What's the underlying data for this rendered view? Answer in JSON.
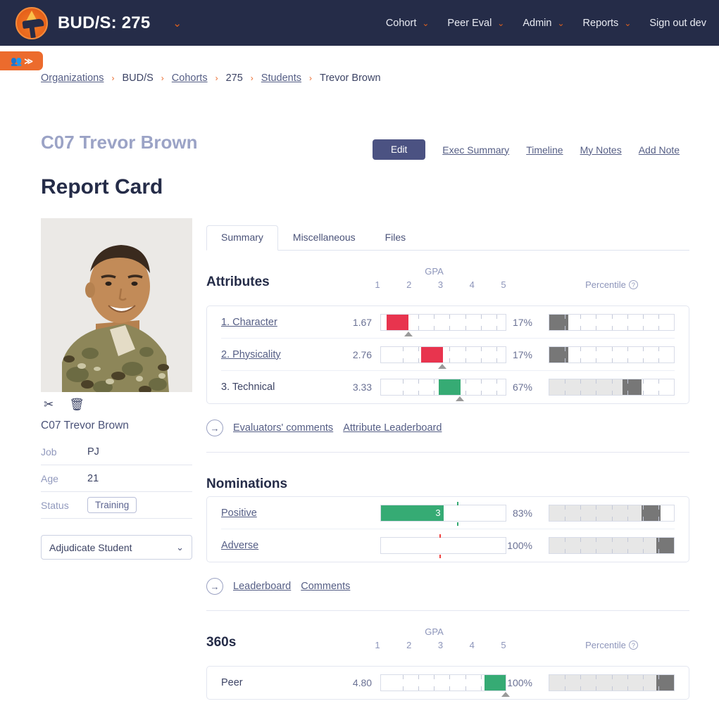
{
  "header": {
    "brand_title": "BUD/S: 275",
    "brand_caret": "⌄",
    "nav": [
      {
        "label": "Cohort",
        "caret": "⌄"
      },
      {
        "label": "Peer Eval",
        "caret": "⌄"
      },
      {
        "label": "Admin",
        "caret": "⌄"
      },
      {
        "label": "Reports",
        "caret": "⌄"
      },
      {
        "label": "Sign out dev",
        "caret": ""
      }
    ],
    "side_toggle": {
      "icon": "people-icon",
      "label": "≫"
    }
  },
  "breadcrumb": {
    "items": [
      {
        "label": "Organizations",
        "link": true
      },
      {
        "label": "BUD/S",
        "link": false
      },
      {
        "label": "Cohorts",
        "link": true
      },
      {
        "label": "275",
        "link": false
      },
      {
        "label": "Students",
        "link": true
      },
      {
        "label": "Trevor Brown",
        "link": false
      }
    ],
    "separator": "›"
  },
  "page": {
    "student_name": "C07 Trevor Brown",
    "title": "Report Card",
    "actions": {
      "edit_label": "Edit",
      "links": [
        "Exec Summary",
        "Timeline",
        "My Notes",
        "Add Note"
      ]
    }
  },
  "profile": {
    "photo_alt": "student-portrait",
    "tools": [
      {
        "name": "crop-icon",
        "glyph": "✂"
      },
      {
        "name": "delete-icon",
        "glyph": "🗑"
      }
    ],
    "name": "C07 Trevor Brown",
    "fields": [
      {
        "key": "Job",
        "value": "PJ",
        "pill": false
      },
      {
        "key": "Age",
        "value": "21",
        "pill": false
      },
      {
        "key": "Status",
        "value": "Training",
        "pill": true
      }
    ],
    "adjudicate": {
      "label": "Adjudicate Student",
      "caret": "⌄"
    }
  },
  "tabs": [
    {
      "label": "Summary",
      "active": true
    },
    {
      "label": "Miscellaneous",
      "active": false
    },
    {
      "label": "Files",
      "active": false
    }
  ],
  "scale": {
    "gpa_header": "GPA",
    "gpa_ticks": [
      "1",
      "2",
      "3",
      "4",
      "5"
    ],
    "percentile_header": "Percentile",
    "help_glyph": "?"
  },
  "colors": {
    "navy": "#252c48",
    "orange": "#ec6b2d",
    "red": "#e8344e",
    "green": "#36ab74",
    "gray_block": "#777777",
    "link": "#555e85"
  },
  "chart_data": [
    {
      "type": "bar",
      "title": "Attributes",
      "xlabel": "GPA",
      "ylabel": "",
      "xlim": [
        0.8,
        4.8
      ],
      "grid": true,
      "categories": [
        "1. Character",
        "2. Physicality",
        "3. Technical"
      ],
      "values": [
        1.67,
        2.76,
        3.33
      ],
      "value_labels": [
        "1.67",
        "2.76",
        "3.33"
      ],
      "bar_colors": [
        "#e8344e",
        "#e8344e",
        "#36ab74"
      ],
      "percentiles": [
        17,
        17,
        67
      ],
      "percentile_labels": [
        "17%",
        "17%",
        "67%"
      ],
      "percentile_progress": [
        17,
        17,
        67
      ],
      "percentile_block_start": [
        0,
        0,
        59
      ],
      "row_links": [
        true,
        true,
        false
      ]
    },
    {
      "type": "bar",
      "title": "Nominations",
      "xlabel": "",
      "ylabel": "",
      "grid": false,
      "categories": [
        "Positive",
        "Adverse"
      ],
      "values": [
        3,
        0
      ],
      "value_labels": [
        "3",
        ""
      ],
      "bar_colors": [
        "#36ab74",
        "#ffffff"
      ],
      "bar_fill_pct": [
        50,
        0
      ],
      "tick_colors": [
        "#36ab74",
        "#f0413f"
      ],
      "tick_pos_pct": [
        61,
        47
      ],
      "percentiles": [
        83,
        100
      ],
      "percentile_labels": [
        "83%",
        "100%"
      ],
      "percentile_progress": [
        83,
        100
      ],
      "percentile_block_start": [
        74,
        86
      ],
      "row_links": [
        true,
        true
      ]
    },
    {
      "type": "bar",
      "title": "360s",
      "xlabel": "GPA",
      "ylabel": "",
      "xlim": [
        0.8,
        4.8
      ],
      "grid": true,
      "categories": [
        "Peer"
      ],
      "values": [
        4.8
      ],
      "value_labels": [
        "4.80"
      ],
      "bar_colors": [
        "#36ab74"
      ],
      "percentiles": [
        100
      ],
      "percentile_labels": [
        "100%"
      ],
      "percentile_progress": [
        100
      ],
      "percentile_block_start": [
        86
      ],
      "row_links": [
        false
      ]
    }
  ],
  "attr_footer_links": [
    "Evaluators' comments",
    "Attribute Leaderboard"
  ],
  "nom_footer_links": [
    "Leaderboard",
    "Comments"
  ],
  "arrow_glyph": "→"
}
